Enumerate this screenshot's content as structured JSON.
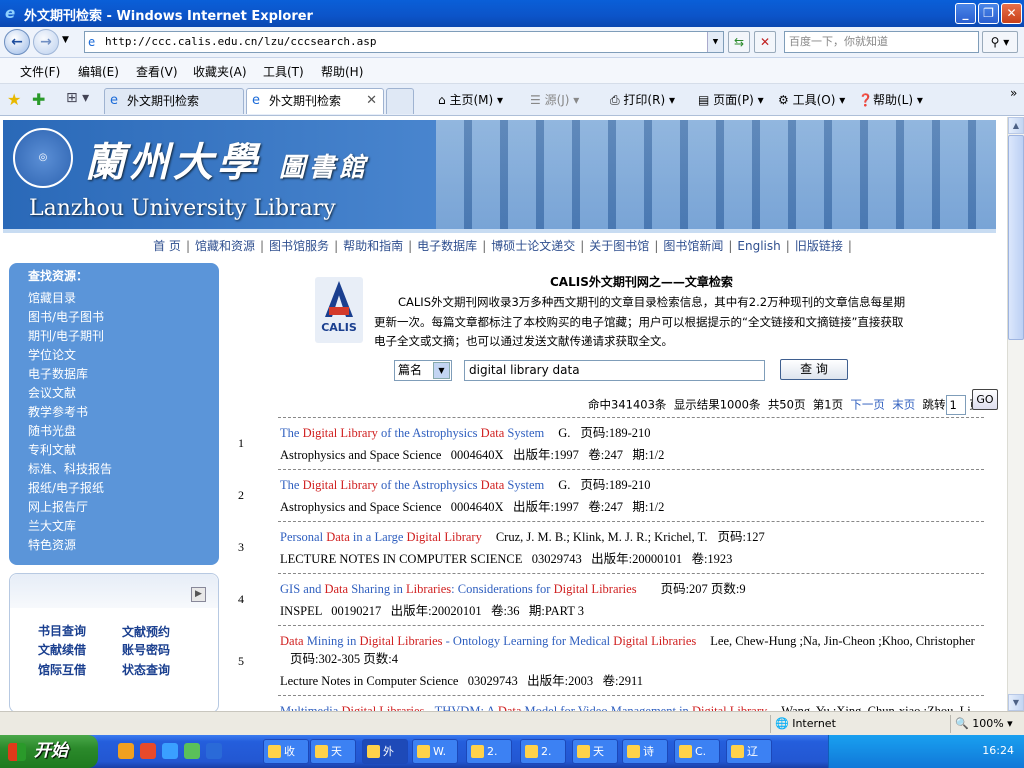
{
  "window": {
    "title": "外文期刊检索 - Windows Internet Explorer"
  },
  "address_bar": {
    "url": "http://ccc.calis.edu.cn/lzu/cccsearch.asp",
    "search_placeholder": "百度一下，你就知道"
  },
  "menu": [
    "文件(F)",
    "编辑(E)",
    "查看(V)",
    "收藏夹(A)",
    "工具(T)",
    "帮助(H)"
  ],
  "tabs": [
    {
      "label": "外文期刊检索"
    },
    {
      "label": "外文期刊检索"
    }
  ],
  "commandbar": [
    "主页(M)",
    "源(J)",
    "打印(R)",
    "页面(P)",
    "工具(O)",
    "帮助(L)"
  ],
  "banner": {
    "cn_title": "蘭州大學",
    "cn_sub": "圖書館",
    "en_title": "Lanzhou University Library"
  },
  "site_nav": [
    "首 页",
    "馆藏和资源",
    "图书馆服务",
    "帮助和指南",
    "电子数据库",
    "博硕士论文递交",
    "关于图书馆",
    "图书馆新闻",
    "English",
    "旧版链接"
  ],
  "sidebar": {
    "heading": "查找资源：",
    "items": [
      "馆藏目录",
      "图书/电子图书",
      "期刊/电子期刊",
      "学位论文",
      "电子数据库",
      "会议文献",
      "教学参考书",
      "随书光盘",
      "专利文献",
      "标准、科技报告",
      "报纸/电子报纸",
      "网上报告厅",
      "兰大文库",
      "特色资源"
    ],
    "links": [
      "书目查询",
      "文献预约",
      "文献续借",
      "账号密码",
      "馆际互借",
      "状态查询"
    ]
  },
  "calis": {
    "logo_text": "CALIS",
    "title": "CALIS外文期刊网之——文章检索",
    "intro": "CALIS外文期刊网收录3万多种西文期刊的文章目录检索信息，其中有2.2万种现刊的文章信息每星期更新一次。每篇文章都标注了本校购买的电子馆藏；用户可以根据提示的“全文链接和文摘链接”直接获取电子全文或文摘；也可以通过发送文献传递请求获取全文。"
  },
  "search": {
    "field": "篇名",
    "query": "digital library  data",
    "button": "查 询"
  },
  "pager": {
    "hits": "命中341403条",
    "shown": "显示结果1000条",
    "pages": "共50页",
    "current": "第1页",
    "next": "下一页",
    "last": "末页",
    "jump_label": "跳转",
    "page_value": "1",
    "page_suffix": "页",
    "go": "GO"
  },
  "results": [
    {
      "num": "1",
      "title": [
        [
          "The ",
          "t"
        ],
        [
          "Digital Library",
          "hl"
        ],
        [
          " of the Astrophysics ",
          "t"
        ],
        [
          "Data",
          "hl"
        ],
        [
          " System",
          "t"
        ]
      ],
      "authors": "G.",
      "pages": "页码:189-210",
      "line2": "Astrophysics and Space Science   0004640X   出版年:1997   卷:247   期:1/2"
    },
    {
      "num": "2",
      "title": [
        [
          "The ",
          "t"
        ],
        [
          "Digital Library",
          "hl"
        ],
        [
          " of the Astrophysics ",
          "t"
        ],
        [
          "Data",
          "hl"
        ],
        [
          " System",
          "t"
        ]
      ],
      "authors": "G.",
      "pages": "页码:189-210",
      "line2": "Astrophysics and Space Science   0004640X   出版年:1997   卷:247   期:1/2"
    },
    {
      "num": "3",
      "title": [
        [
          "Personal ",
          "t"
        ],
        [
          "Data",
          "hl"
        ],
        [
          " in a Large ",
          "t"
        ],
        [
          "Digital Library",
          "hl"
        ]
      ],
      "authors": "Cruz, J. M. B.; Klink, M. J. R.; Krichel, T.",
      "pages": "页码:127",
      "line2": "LECTURE NOTES IN COMPUTER SCIENCE   03029743   出版年:20000101   卷:1923"
    },
    {
      "num": "4",
      "title": [
        [
          "GIS and ",
          "t"
        ],
        [
          "Data",
          "hl"
        ],
        [
          " Sharing in ",
          "t"
        ],
        [
          "Libraries",
          "hl"
        ],
        [
          ": Considerations for ",
          "t"
        ],
        [
          "Digital Libraries",
          "hl"
        ]
      ],
      "authors": "",
      "pages": "页码:207   页数:9",
      "line2": "INSPEL   00190217   出版年:20020101   卷:36   期:PART 3"
    },
    {
      "num": "5",
      "title": [
        [
          "Data",
          "hl"
        ],
        [
          " Mining in ",
          "t"
        ],
        [
          "Digital Libraries",
          "hl"
        ],
        [
          " - Ontology Learning for Medical ",
          "t"
        ],
        [
          "Digital Libraries",
          "hl"
        ]
      ],
      "authors": "Lee, Chew-Hung ;Na, Jin-Cheon ;Khoo, Christopher",
      "pages": "页码:302-305   页数:4",
      "line2": "Lecture Notes in Computer Science   03029743   出版年:2003   卷:2911"
    },
    {
      "num": "6",
      "title": [
        [
          "Multimedia ",
          "t"
        ],
        [
          "Digital Libraries",
          "hl"
        ],
        [
          " - THVDM: A ",
          "t"
        ],
        [
          "Data",
          "hl"
        ],
        [
          " Model for Video Management in ",
          "t"
        ],
        [
          "Digital Library",
          "hl"
        ]
      ],
      "authors": "Wang, Yu ;Xing, Chun-xiao ;Zhou, Li-",
      "pages": "",
      "line2": ""
    }
  ],
  "status": {
    "zone": "Internet",
    "zoom": "100%"
  },
  "taskbar": {
    "start": "开始",
    "buttons": [
      "收",
      "天",
      "外",
      "W.",
      "2.",
      "2.",
      "天",
      "诗",
      "C.",
      "辽"
    ],
    "clock": "16:24"
  }
}
